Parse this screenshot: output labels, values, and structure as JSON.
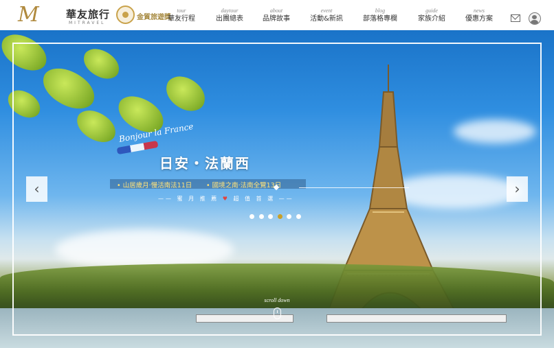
{
  "brand": {
    "script_mark": "M",
    "name_cn": "華友旅行",
    "name_en": "MITRAVEL",
    "award": "金質旅遊獎"
  },
  "nav": [
    {
      "en": "tour",
      "cn": "華友行程"
    },
    {
      "en": "daytour",
      "cn": "出團總表"
    },
    {
      "en": "about",
      "cn": "品牌故事"
    },
    {
      "en": "event",
      "cn": "活動&新訊"
    },
    {
      "en": "blog",
      "cn": "部落格專欄"
    },
    {
      "en": "guide",
      "cn": "家族介紹"
    },
    {
      "en": "news",
      "cn": "優惠方案"
    }
  ],
  "icons": {
    "mail": "mail-icon",
    "user": "user-avatar-icon",
    "prev": "chevron-left-icon",
    "next": "chevron-right-icon",
    "mouse": "mouse-icon"
  },
  "slide": {
    "tag": "Bonjour la France",
    "title": "日安・法蘭西",
    "sub_left": "• 山居歲月‧慢活南法11日",
    "sub_right": "• 國境之南‧法南全覽13日",
    "tagline_left": "—— 蜜 月 推 薦",
    "tagline_heart": "♥",
    "tagline_right": "超 值 首 選 ——"
  },
  "carousel": {
    "prev_label": "‹",
    "next_label": "›",
    "slide_count": 6,
    "active_index": 3
  },
  "scroll": {
    "label": "scroll down"
  },
  "colors": {
    "brand_gold": "#b08a3e",
    "active_dot": "#c9a028",
    "subtitle": "#ffe27a"
  }
}
